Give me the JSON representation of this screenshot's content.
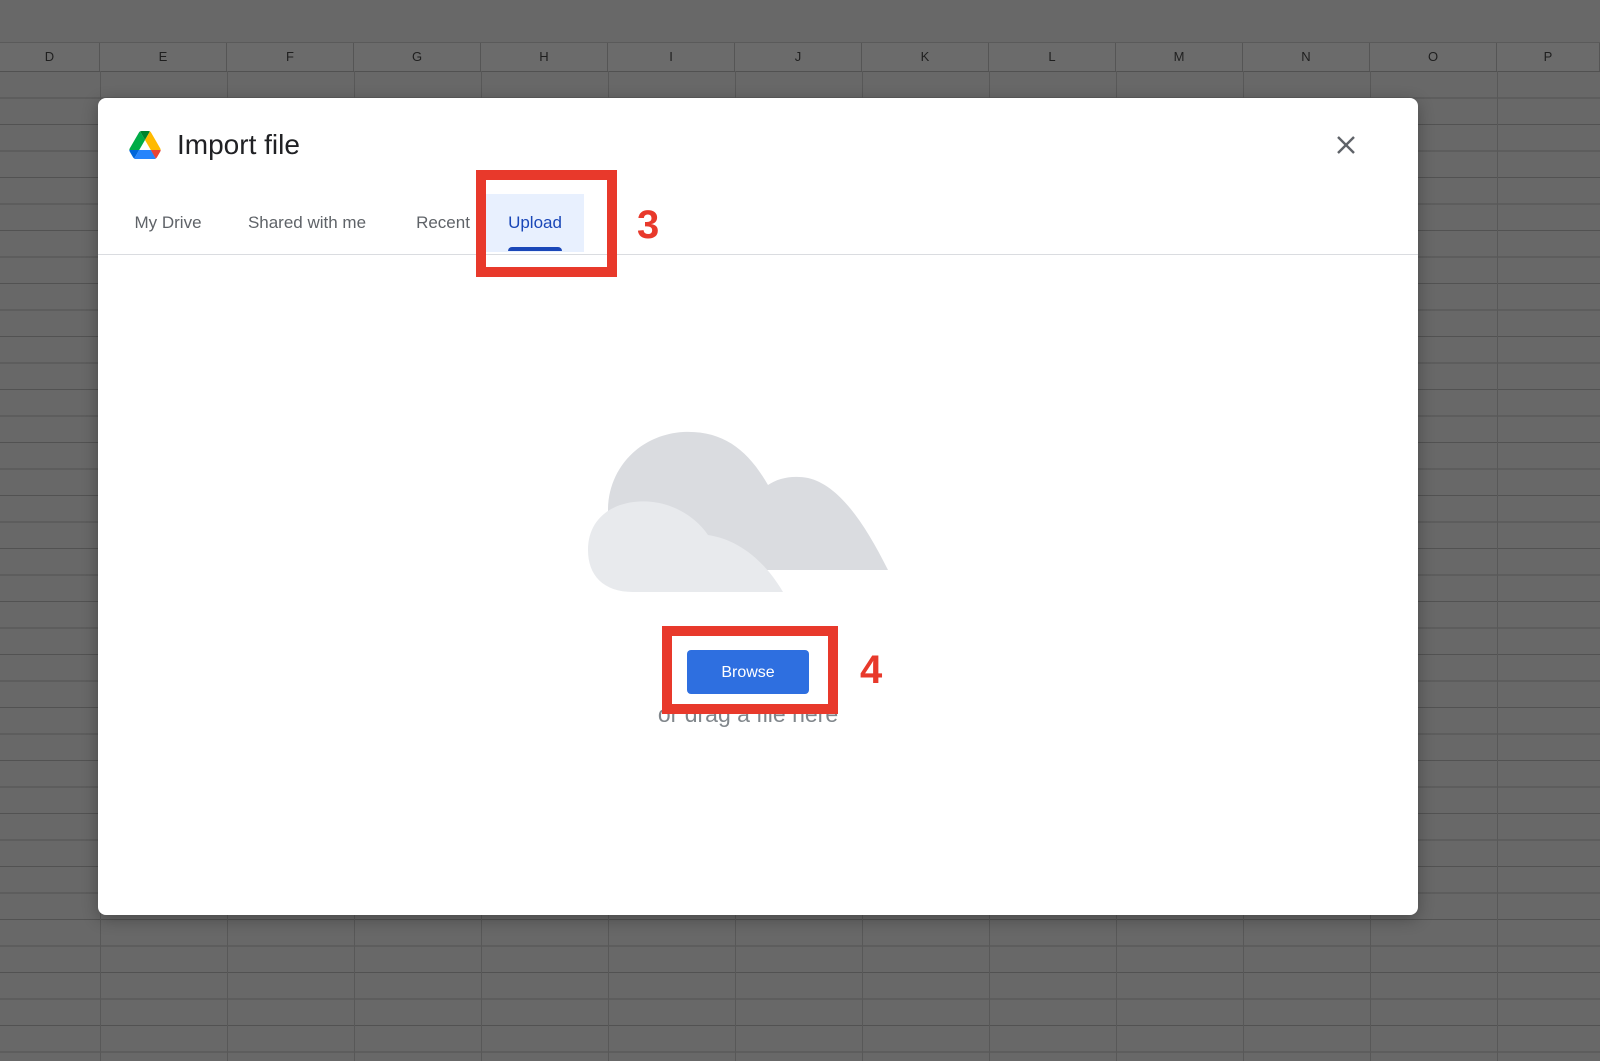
{
  "sheet": {
    "columns": [
      "D",
      "E",
      "F",
      "G",
      "H",
      "I",
      "J",
      "K",
      "L",
      "M",
      "N",
      "O",
      "P"
    ]
  },
  "dialog": {
    "title": "Import file",
    "tabs": [
      {
        "label": "My Drive",
        "active": false
      },
      {
        "label": "Shared with me",
        "active": false
      },
      {
        "label": "Recent",
        "active": false
      },
      {
        "label": "Upload",
        "active": true
      }
    ],
    "browse_label": "Browse",
    "drag_text": "or drag a file here"
  },
  "annotations": {
    "step_upload": "3",
    "step_browse": "4",
    "color": "#e8392b"
  },
  "colors": {
    "accent": "#1a47b8",
    "button": "#2e6fe0"
  }
}
